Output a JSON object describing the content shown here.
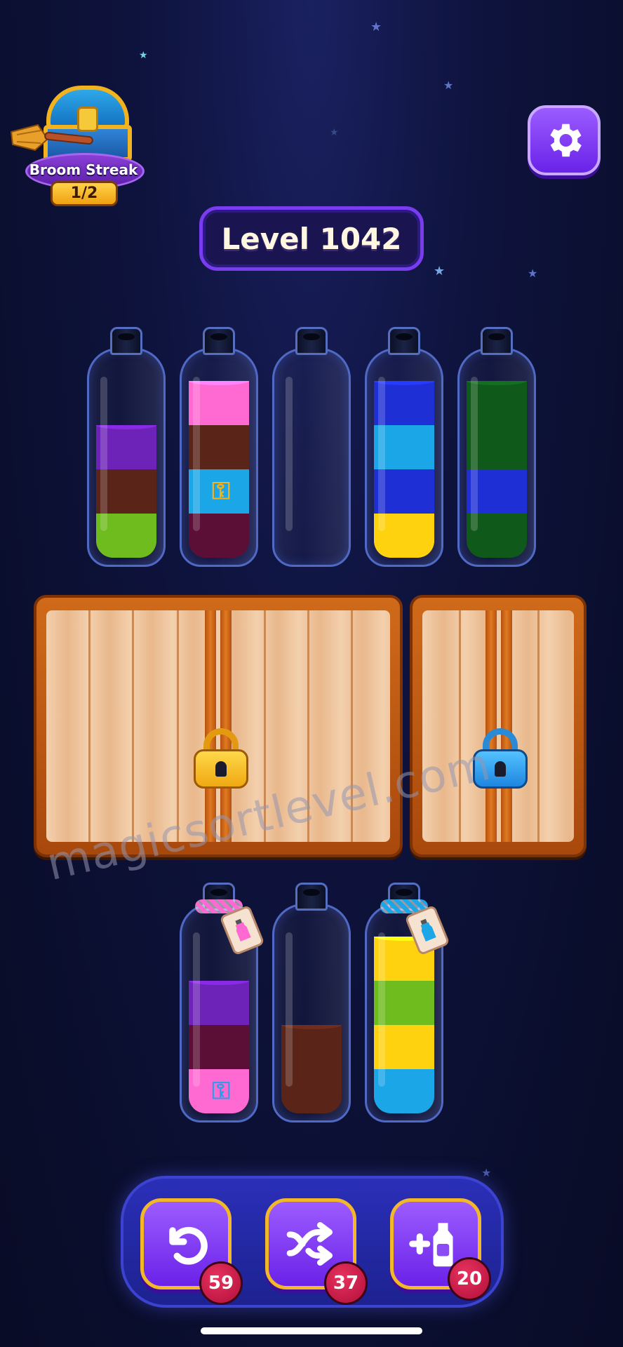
{
  "colors": {
    "background": "#0b0f30",
    "purple": "#6d22b8",
    "brown": "#5a2418",
    "green": "#6fbc1e",
    "pink": "#ff6ad2",
    "maroon": "#5c0f36",
    "sky": "#1ba6e8",
    "blue": "#1f2fd6",
    "yellow": "#ffd20f",
    "darkgreen": "#0f5a1a",
    "keyGold": "#f6b21a",
    "keyBlue": "#2a9ee8"
  },
  "streak": {
    "label": "Broom Streak",
    "count": "1/2",
    "icon": "treasure-chest-icon"
  },
  "settings": {
    "icon": "gear-icon"
  },
  "level": {
    "label": "Level 1042"
  },
  "top_bottles": [
    {
      "layers": [
        "green",
        "brown",
        "purple"
      ],
      "key": null
    },
    {
      "layers": [
        "maroon",
        "sky",
        "brown",
        "pink"
      ],
      "key": {
        "layer": 1,
        "color": "keyGold"
      }
    },
    {
      "layers": [],
      "key": null
    },
    {
      "layers": [
        "yellow",
        "blue",
        "sky",
        "blue"
      ],
      "key": null
    },
    {
      "layers": [
        "darkgreen",
        "blue",
        "darkgreen",
        "darkgreen"
      ],
      "key": null
    }
  ],
  "crates": [
    {
      "lock": "gold-padlock-icon",
      "lockColor": "keyGold"
    },
    {
      "lock": "blue-padlock-icon",
      "lockColor": "keyBlue"
    }
  ],
  "bottom_bottles": [
    {
      "layers": [
        "pink",
        "maroon",
        "purple"
      ],
      "key": {
        "layer": 0,
        "color": "keyBlue"
      },
      "tied": "pink"
    },
    {
      "layers": [
        "brown",
        "brown"
      ],
      "key": null,
      "tied": null
    },
    {
      "layers": [
        "sky",
        "yellow",
        "green",
        "yellow"
      ],
      "key": null,
      "tied": "sky"
    }
  ],
  "watermark": "magicsortlevel.com",
  "tools": [
    {
      "name": "undo",
      "icon": "undo-icon",
      "count": "59"
    },
    {
      "name": "shuffle",
      "icon": "shuffle-icon",
      "count": "37"
    },
    {
      "name": "add-bottle",
      "icon": "add-bottle-icon",
      "count": "20"
    }
  ]
}
